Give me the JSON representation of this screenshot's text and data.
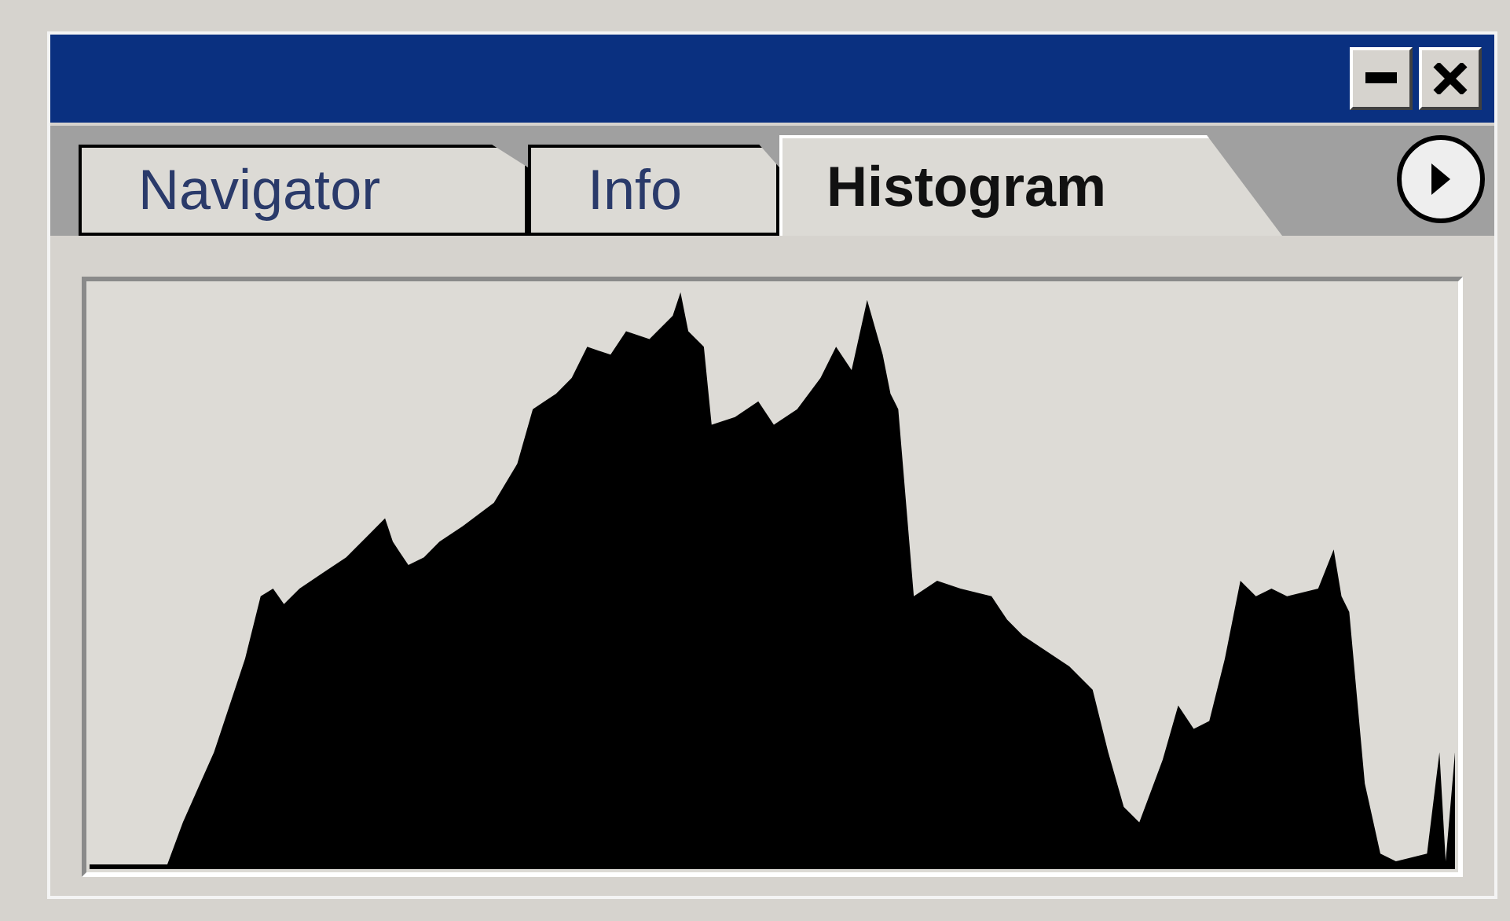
{
  "tabs": [
    {
      "label": "Navigator",
      "selected": false
    },
    {
      "label": "Info",
      "selected": false
    },
    {
      "label": "Histogram",
      "selected": true
    }
  ]
}
